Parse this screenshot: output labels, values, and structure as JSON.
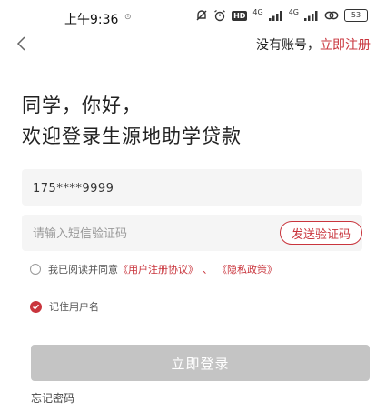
{
  "status_bar": {
    "time": "上午9:36",
    "dot": "⊙",
    "hd": "HD",
    "net1": "4G",
    "net2": "4G",
    "battery": "53"
  },
  "header": {
    "no_account": "没有账号，",
    "register": "立即注册"
  },
  "greeting": {
    "line1": "同学，你好，",
    "line2": "欢迎登录生源地助学贷款"
  },
  "form": {
    "phone_value": "175****9999",
    "code_placeholder": "请输入短信验证码",
    "send_code": "发送验证码"
  },
  "agreement": {
    "prefix": "我已阅读并同意",
    "user_agreement": "《用户注册协议》",
    "separator": "、",
    "privacy_policy": "《隐私政策》"
  },
  "remember": {
    "label": "记住用户名",
    "checked": true
  },
  "login_button": "立即登录",
  "forgot_password": "忘记密码",
  "colors": {
    "accent": "#c9353d",
    "disabled_button": "#c4c4c4",
    "field_bg": "#f5f5f5"
  }
}
